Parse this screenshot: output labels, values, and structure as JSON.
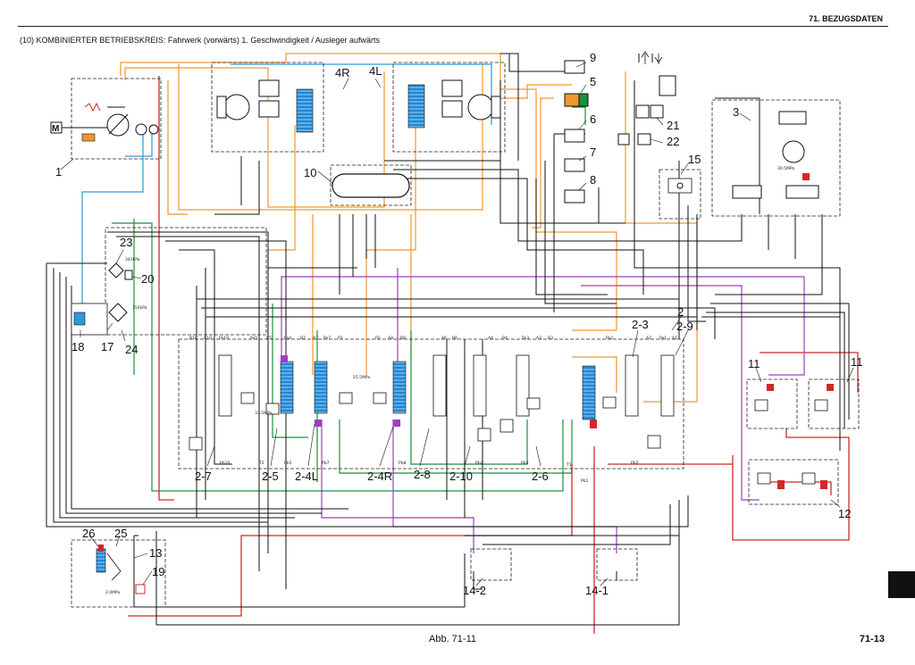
{
  "header": {
    "section_title": "71. BEZUGSDATEN",
    "circuit_title": "(10) KOMBINIERTER BETRIEBSKREIS: Fahrwerk (vorwärts) 1. Geschwindigkeit / Ausleger aufwärts"
  },
  "footer": {
    "figure_caption": "Abb. 71-11",
    "page_number": "71-13"
  },
  "colors": {
    "tank": "#2d9ad6",
    "pilot": "#f0962d",
    "pump_delivery": "#d22828",
    "boom": "#1a8f3c",
    "travel": "#9b3fc0",
    "lines": "#111111",
    "spool_highlight": "#1e88d6"
  },
  "component_labels": {
    "c1": "1",
    "c2": "2",
    "c3": "3",
    "c4L": "4L",
    "c4R": "4R",
    "c5": "5",
    "c6": "6",
    "c7": "7",
    "c8": "8",
    "c9": "9",
    "c10": "10",
    "c11a": "11",
    "c11b": "11",
    "c12": "12",
    "c13": "13",
    "c14_1": "14-1",
    "c14_2": "14-2",
    "c15": "15",
    "c17": "17",
    "c18": "18",
    "c19": "19",
    "c20": "20",
    "c21": "21",
    "c22": "22",
    "c23": "23",
    "c24": "24",
    "c25": "25",
    "c26": "26",
    "c2_3": "2-3",
    "c2_9": "2-9",
    "c2_7": "2-7",
    "c2_5": "2-5",
    "c2_4L": "2-4L",
    "c2_4R": "2-4R",
    "c2_8": "2-8",
    "c2_10": "2-10",
    "c2_6": "2-6"
  },
  "pump_symbol": "M",
  "port_codes": [
    "B10",
    "A10",
    "Pa10",
    "Pa5",
    "B5",
    "Pa4",
    "B7",
    "A7",
    "Pa7",
    "P1",
    "P2",
    "A8",
    "B8",
    "A6",
    "B6",
    "A4",
    "B4",
    "Pa3",
    "A3",
    "B3",
    "Pa2",
    "A2",
    "Pa1",
    "A1",
    "Pb10",
    "T2",
    "Pb5",
    "Pb7",
    "Pb8",
    "Pb4",
    "Pb3",
    "Pb2",
    "Pb1",
    "T1"
  ],
  "pressure_notes": [
    "25.5MPa",
    "37.5MPa",
    "150kPa",
    "343kPa",
    "30.5MPa",
    "2.0MPa"
  ]
}
